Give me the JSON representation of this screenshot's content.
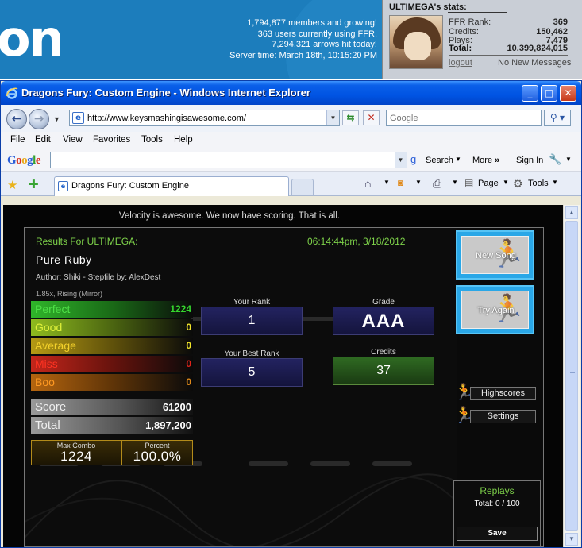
{
  "site": {
    "logo_fragment": "on",
    "stats_lines": [
      "1,794,877 members and growing!",
      "363 users currently using FFR.",
      "7,294,321 arrows hit today!",
      "Server time: March 18th, 10:15:20 PM"
    ],
    "user_panel": {
      "title": "ULTIMEGA's stats:",
      "rows": [
        {
          "label": "FFR Rank:",
          "value": "369"
        },
        {
          "label": "Credits:",
          "value": "150,462"
        },
        {
          "label": "Plays:",
          "value": "7,479"
        },
        {
          "label": "Total:",
          "value": "10,399,824,015"
        }
      ],
      "logout": "logout",
      "messages": "No New Messages"
    }
  },
  "browser": {
    "window_title": "Dragons Fury: Custom Engine - Windows Internet Explorer",
    "url": "http://www.keysmashingisawesome.com/",
    "search_placeholder": "Google",
    "menu": [
      "File",
      "Edit",
      "View",
      "Favorites",
      "Tools",
      "Help"
    ],
    "google_toolbar": {
      "logo": "Google",
      "search": "Search",
      "more": "More",
      "sign_in": "Sign In"
    },
    "tab_title": "Dragons Fury: Custom Engine",
    "commands": {
      "page": "Page",
      "tools": "Tools"
    }
  },
  "game": {
    "velocity_msg": "Velocity is awesome. We now have scoring. That is all.",
    "results_for": "Results For ULTIMEGA:",
    "datetime": "06:14:44pm, 3/18/2012",
    "song_title": "Pure Ruby",
    "author_line": "Author: Shiki  -  Stepfile by: AlexDest",
    "mods": "1.85x, Rising (Mirror)",
    "judgements": [
      {
        "label": "Perfect",
        "value": "1224",
        "color": "#2fb52a",
        "text_color": "#35d52d"
      },
      {
        "label": "Good",
        "value": "0",
        "color": "#8fbb1f",
        "text_color": "#f2e52a"
      },
      {
        "label": "Average",
        "value": "0",
        "color": "#b59a14",
        "text_color": "#f2e52a"
      },
      {
        "label": "Miss",
        "value": "0",
        "color": "#c4261b",
        "text_color": "#e0231a"
      },
      {
        "label": "Boo",
        "value": "0",
        "color": "#b5650f",
        "text_color": "#e08a1a"
      }
    ],
    "score_label": "Score",
    "score_value": "61200",
    "total_label": "Total",
    "total_value": "1,897,200",
    "max_combo_label": "Max Combo",
    "max_combo_value": "1224",
    "percent_label": "Percent",
    "percent_value": "100.0%",
    "your_rank_label": "Your Rank",
    "your_rank_value": "1",
    "grade_label": "Grade",
    "grade_value": "AAA",
    "best_rank_label": "Your Best Rank",
    "best_rank_value": "5",
    "credits_label": "Credits",
    "credits_value": "37",
    "new_song": "New Song",
    "try_again": "Try Again",
    "highscores": "Highscores",
    "settings": "Settings",
    "replays_title": "Replays",
    "replays_total": "Total: 0 / 100",
    "save": "Save"
  }
}
